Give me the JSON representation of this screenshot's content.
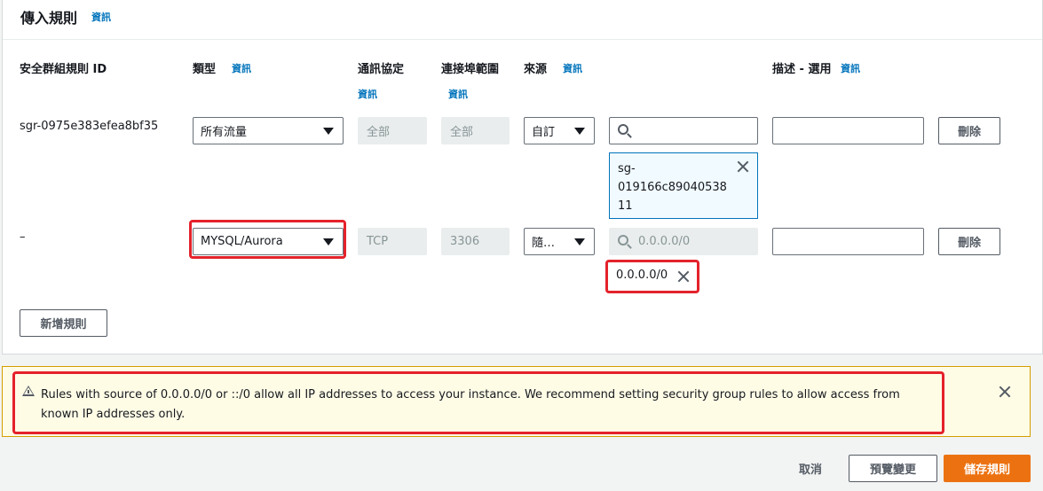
{
  "panel": {
    "title": "傳入規則",
    "info": "資訊"
  },
  "columns": {
    "rule_id": "安全群組規則 ID",
    "type": "類型",
    "type_info": "資訊",
    "protocol": "通訊協定",
    "protocol_info": "資訊",
    "port_range": "連接埠範圍",
    "port_range_info": "資訊",
    "source": "來源",
    "source_info": "資訊",
    "description": "描述 - 選用",
    "description_info": "資訊"
  },
  "rows": [
    {
      "id": "sgr-0975e383efea8bf35",
      "type": "所有流量",
      "protocol": "全部",
      "port_range": "全部",
      "source_type": "自訂",
      "search_value": "",
      "token_line1": "sg-",
      "token_line2": "019166c89040538",
      "token_line3": "11",
      "description": "",
      "delete": "刪除"
    },
    {
      "id": "–",
      "type": "MYSQL/Aurora",
      "protocol": "TCP",
      "port_range": "3306",
      "source_type": "隨…",
      "search_placeholder": "0.0.0.0/0",
      "token": "0.0.0.0/0",
      "description": "",
      "delete": "刪除"
    }
  ],
  "add_rule": "新增規則",
  "alert": {
    "message": "Rules with source of 0.0.0.0/0 or ::/0 allow all IP addresses to access your instance. We recommend setting security group rules to allow access from known IP addresses only."
  },
  "footer": {
    "cancel": "取消",
    "preview": "預覽變更",
    "save": "儲存規則"
  },
  "colors": {
    "accent": "#0073bb",
    "primary": "#ec7211",
    "highlight": "#e4222b",
    "warning_bg": "#fffce6"
  }
}
